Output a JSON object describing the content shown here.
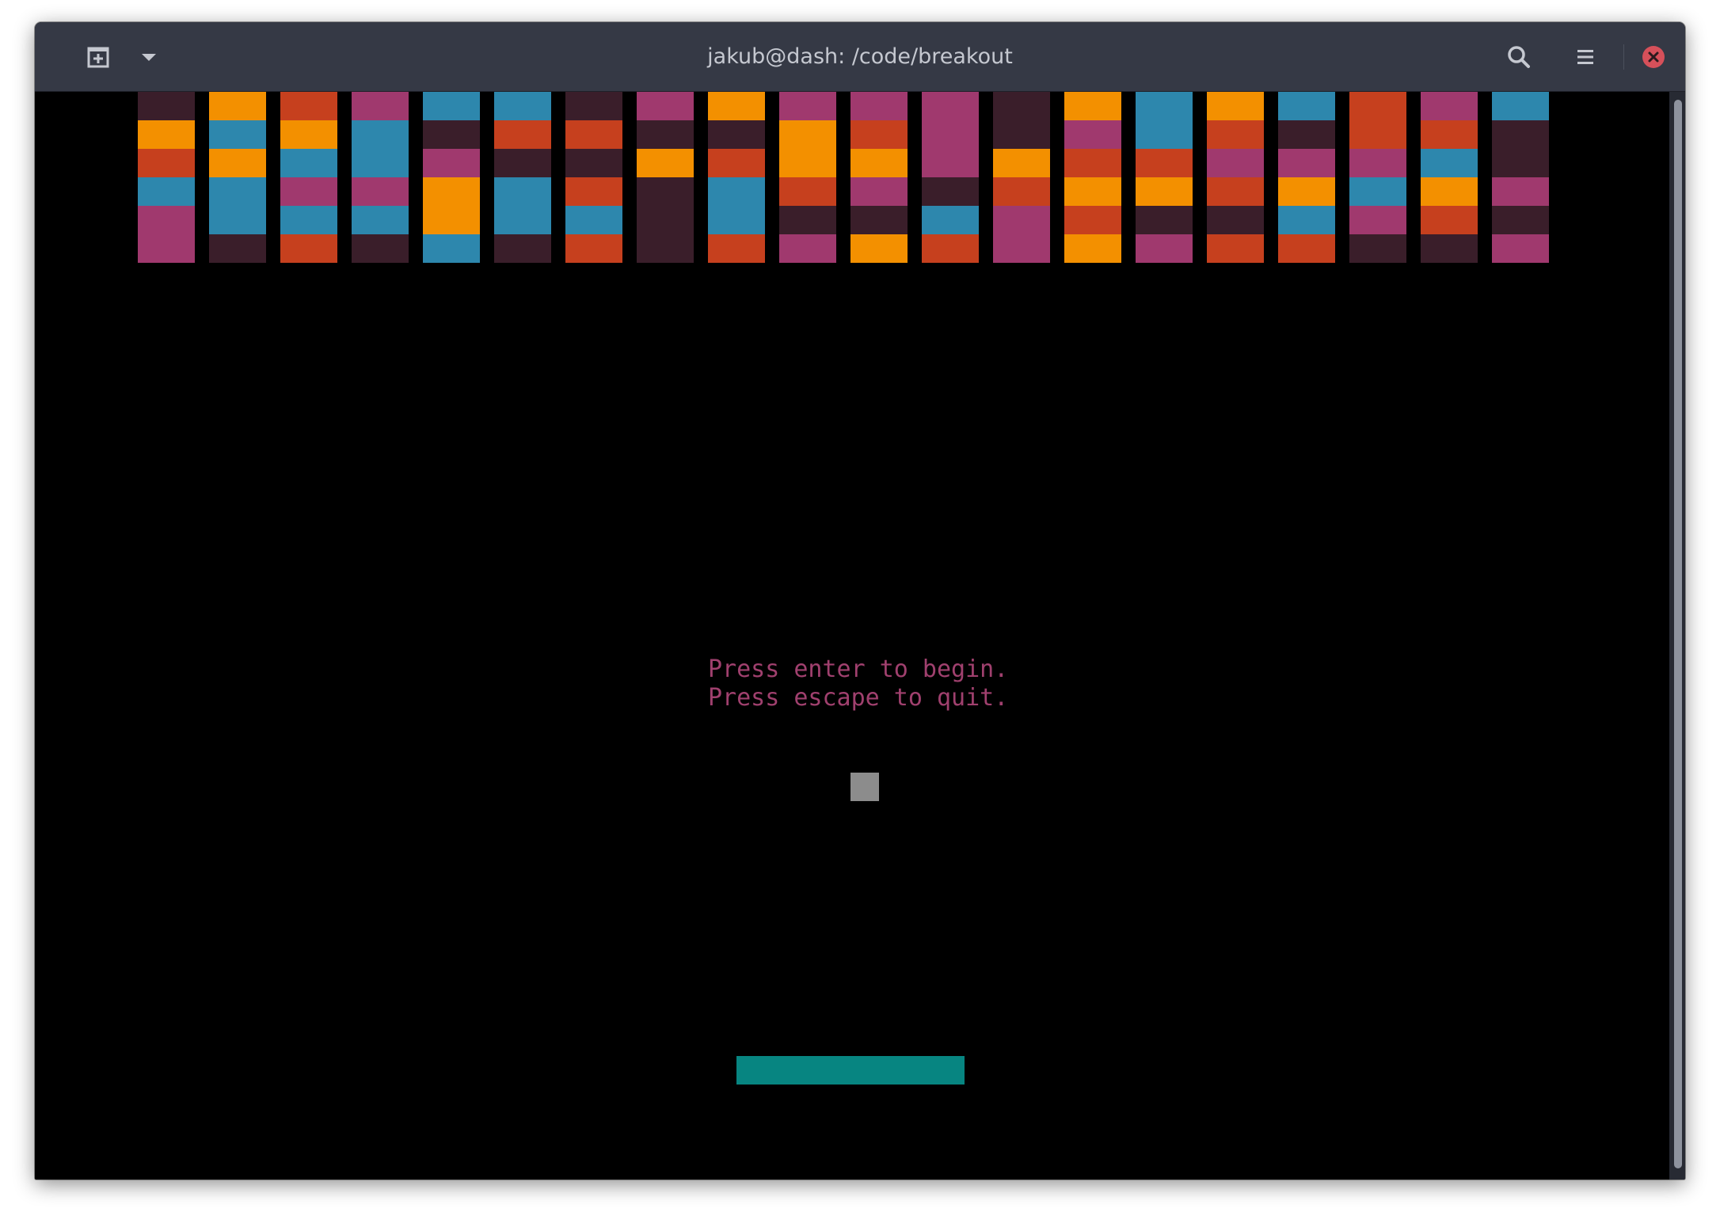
{
  "window": {
    "title": "jakub@dash: /code/breakout"
  },
  "titlebar": {
    "new_tab_icon": "new-tab-icon",
    "dropdown_icon": "chevron-down-icon",
    "search_icon": "search-icon",
    "menu_icon": "hamburger-menu-icon",
    "close_icon": "close-icon"
  },
  "colors": {
    "titlebar_bg": "#353945",
    "terminal_bg": "#000000",
    "close_button": "#d6505a",
    "dark": "#3a1e2a",
    "orange": "#f39000",
    "red": "#c6401e",
    "blue": "#2d87ad",
    "magenta": "#a0396e",
    "text": "#a0406e",
    "ball": "#8c8c8c",
    "paddle": "#078581"
  },
  "game": {
    "message_line1": "Press enter to begin.",
    "message_line2": "Press escape to quit.",
    "brick_columns": [
      [
        "dark",
        "orange",
        "red",
        "blue",
        "magenta",
        "magenta"
      ],
      [
        "orange",
        "blue",
        "orange",
        "blue",
        "blue",
        "dark"
      ],
      [
        "red",
        "orange",
        "blue",
        "magenta",
        "blue",
        "red"
      ],
      [
        "magenta",
        "blue",
        "blue",
        "magenta",
        "blue",
        "dark"
      ],
      [
        "blue",
        "dark",
        "magenta",
        "orange",
        "orange",
        "blue"
      ],
      [
        "blue",
        "red",
        "dark",
        "blue",
        "blue",
        "dark"
      ],
      [
        "dark",
        "red",
        "dark",
        "red",
        "blue",
        "red"
      ],
      [
        "magenta",
        "dark",
        "orange",
        "dark",
        "dark",
        "dark"
      ],
      [
        "orange",
        "dark",
        "red",
        "blue",
        "blue",
        "red"
      ],
      [
        "magenta",
        "orange",
        "orange",
        "red",
        "dark",
        "magenta"
      ],
      [
        "magenta",
        "red",
        "orange",
        "magenta",
        "dark",
        "orange"
      ],
      [
        "magenta",
        "magenta",
        "magenta",
        "dark",
        "blue",
        "red"
      ],
      [
        "dark",
        "dark",
        "orange",
        "red",
        "magenta",
        "magenta"
      ],
      [
        "orange",
        "magenta",
        "red",
        "orange",
        "red",
        "orange"
      ],
      [
        "blue",
        "blue",
        "red",
        "orange",
        "dark",
        "magenta"
      ],
      [
        "orange",
        "red",
        "magenta",
        "red",
        "dark",
        "red"
      ],
      [
        "blue",
        "dark",
        "magenta",
        "orange",
        "blue",
        "red"
      ],
      [
        "red",
        "red",
        "magenta",
        "blue",
        "magenta",
        "dark"
      ],
      [
        "magenta",
        "red",
        "blue",
        "orange",
        "red",
        "dark"
      ],
      [
        "blue",
        "dark",
        "dark",
        "magenta",
        "dark",
        "magenta"
      ]
    ]
  }
}
